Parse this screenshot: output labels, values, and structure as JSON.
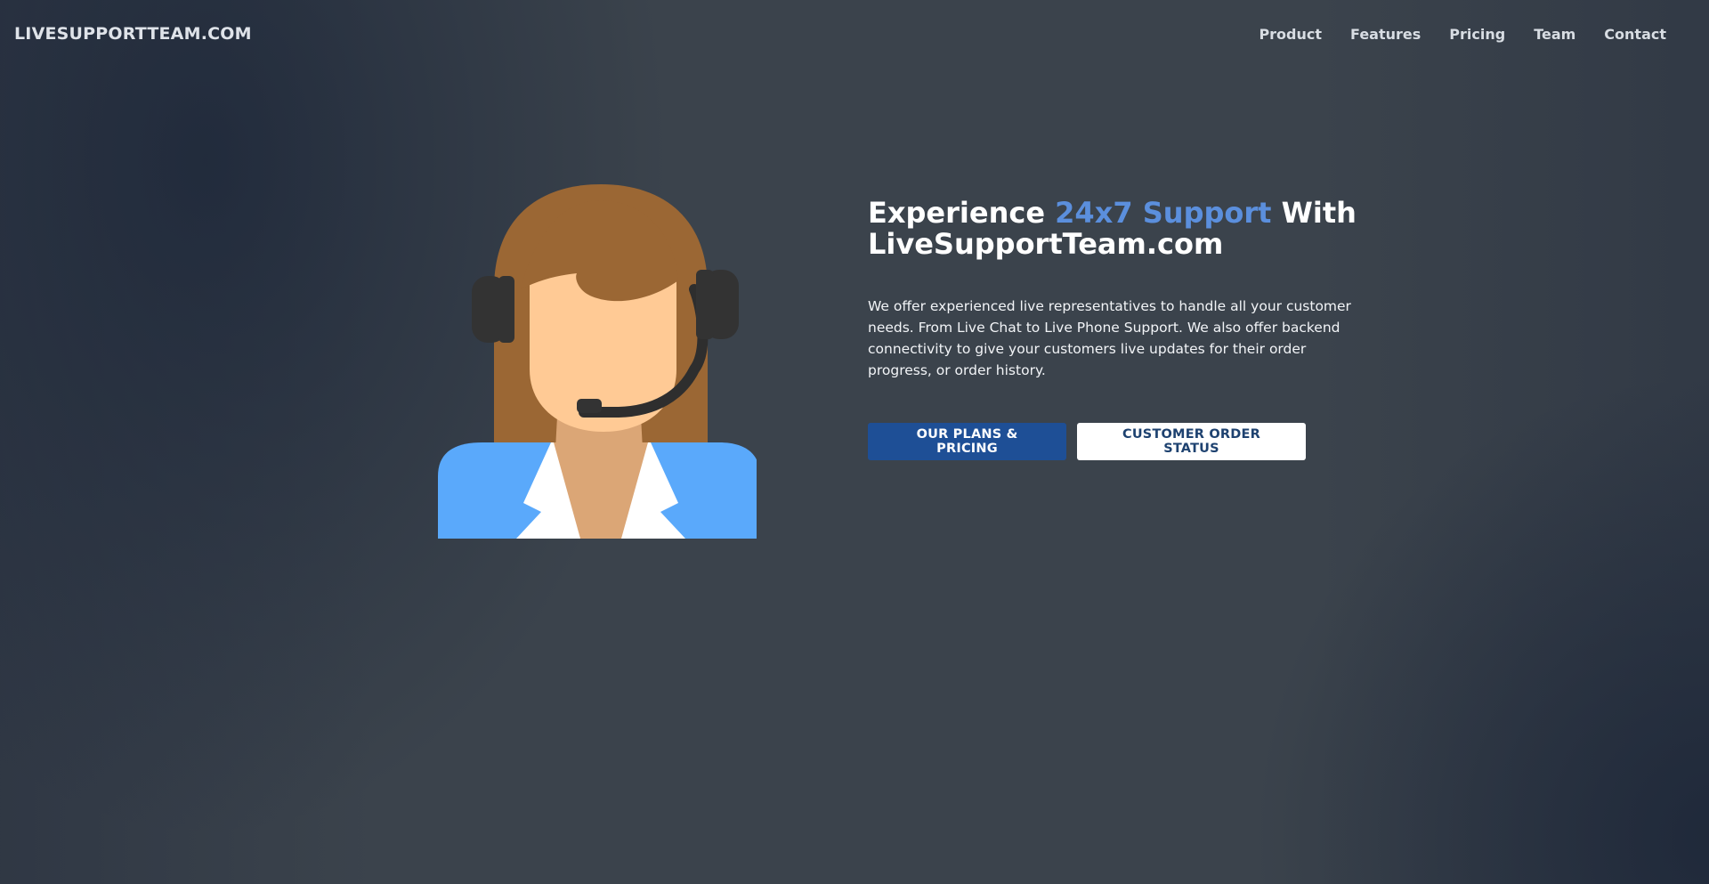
{
  "nav": {
    "brand": "LIVESUPPORTTEAM.COM",
    "links": [
      {
        "label": "Product"
      },
      {
        "label": "Features"
      },
      {
        "label": "Pricing"
      },
      {
        "label": "Team"
      },
      {
        "label": "Contact"
      }
    ]
  },
  "hero": {
    "headline_part1": "Experience ",
    "headline_accent": "24x7 Support",
    "headline_part2": " With",
    "headline_line2": "LiveSupportTeam.com",
    "description": "We offer experienced live representatives to handle all your customer needs. From Live Chat to Live Phone Support. We also offer backend connectivity to give your customers live updates for their order progress, or order history.",
    "primary_button": "OUR PLANS & PRICING",
    "secondary_button": "CUSTOMER ORDER STATUS",
    "illustration_icon": "support-agent-headset-icon"
  },
  "colors": {
    "background": "#3b434c",
    "accent": "#5b8fdd",
    "primary_button": "#1e4f96",
    "secondary_button_text": "#1e4270"
  }
}
